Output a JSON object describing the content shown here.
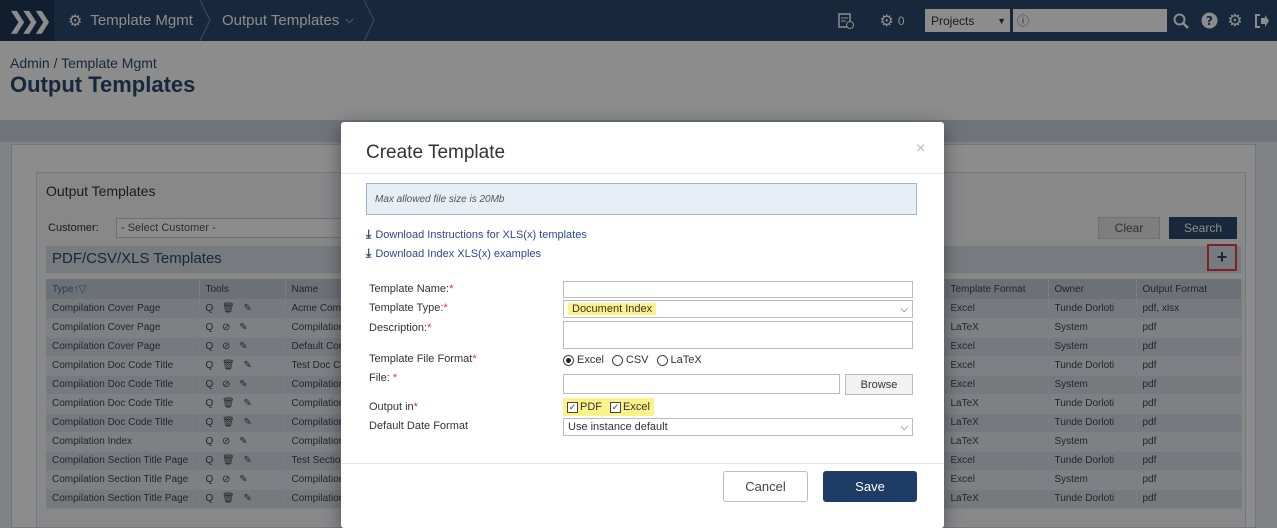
{
  "topbar": {
    "app_name": "Template Mgmt",
    "page_name": "Output Templates",
    "jobs_count": "0",
    "projects_label": "Projects",
    "search_prefix": "ⓘ"
  },
  "header": {
    "breadcrumb": "Admin / Template Mgmt",
    "title": "Output Templates"
  },
  "background": {
    "panel_title": "Output Templates",
    "customer_label": "Customer:",
    "customer_placeholder": "- Select Customer -",
    "clear_label": "Clear",
    "search_label": "Search",
    "section_title": "PDF/CSV/XLS Templates",
    "add_label": "+",
    "columns": [
      "Type↑▽",
      "Tools",
      "Name",
      "Template Format",
      "Owner",
      "Output Format"
    ],
    "rows": [
      {
        "type": "Compilation Cover Page",
        "tools": "Q 🗑 ✎",
        "name": "Acme Comp",
        "format": "Excel",
        "owner": "Tunde Dorloti",
        "output": "pdf, xlsx"
      },
      {
        "type": "Compilation Cover Page",
        "tools": "Q ⊘ ✎",
        "name": "Compilation",
        "format": "LaTeX",
        "owner": "System",
        "output": "pdf"
      },
      {
        "type": "Compilation Cover Page",
        "tools": "Q ⊘ ✎",
        "name": "Default Cor",
        "format": "Excel",
        "owner": "System",
        "output": "pdf"
      },
      {
        "type": "Compilation Doc Code Title",
        "tools": "Q 🗑 ✎",
        "name": "Test Doc Co",
        "format": "Excel",
        "owner": "Tunde Dorloti",
        "output": "pdf"
      },
      {
        "type": "Compilation Doc Code Title",
        "tools": "Q ⊘ ✎",
        "name": "Compilation",
        "format": "Excel",
        "owner": "System",
        "output": "pdf"
      },
      {
        "type": "Compilation Doc Code Title",
        "tools": "Q 🗑 ✎",
        "name": "Compilation",
        "format": "LaTeX",
        "owner": "Tunde Dorloti",
        "output": "pdf"
      },
      {
        "type": "Compilation Doc Code Title",
        "tools": "Q 🗑 ✎",
        "name": "Compilation",
        "format": "LaTeX",
        "owner": "Tunde Dorloti",
        "output": "pdf"
      },
      {
        "type": "Compilation Index",
        "tools": "Q ⊘ ✎",
        "name": "Compilation",
        "format": "LaTeX",
        "owner": "System",
        "output": "pdf"
      },
      {
        "type": "Compilation Section Title Page",
        "tools": "Q 🗑 ✎",
        "name": "Test Section",
        "format": "Excel",
        "owner": "Tunde Dorloti",
        "output": "pdf"
      },
      {
        "type": "Compilation Section Title Page",
        "tools": "Q ⊘ ✎",
        "name": "Compilation",
        "format": "Excel",
        "owner": "System",
        "output": "pdf"
      },
      {
        "type": "Compilation Section Title Page",
        "tools": "Q 🗑 ✎",
        "name": "Compilation",
        "format": "LaTeX",
        "owner": "Tunde Dorloti",
        "output": "pdf"
      }
    ]
  },
  "modal": {
    "title": "Create Template",
    "close": "×",
    "info": "Max allowed file size is 20Mb",
    "download_instructions": "Download Instructions for XLS(x) templates",
    "download_examples": "Download Index XLS(x) examples",
    "name_label": "Template Name:",
    "type_label": "Template Type:",
    "type_value": "Document Index",
    "description_label": "Description:",
    "format_label": "Template File Format",
    "format_options": [
      "Excel",
      "CSV",
      "LaTeX"
    ],
    "file_label": "File: ",
    "browse_label": "Browse",
    "output_label": "Output in",
    "output_options": [
      "PDF",
      "Excel"
    ],
    "date_label": "Default Date Format",
    "date_value": "Use instance default",
    "cancel_label": "Cancel",
    "save_label": "Save",
    "required_mark": "*"
  }
}
